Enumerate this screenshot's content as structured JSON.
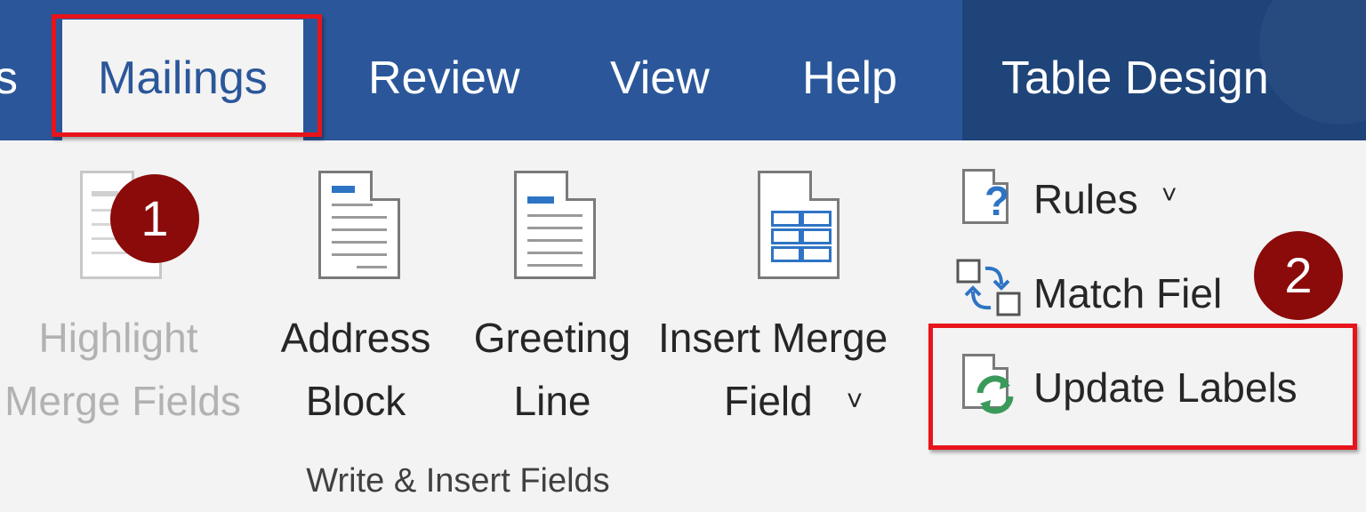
{
  "ribbon_tabs": {
    "partial_left": "s",
    "mailings": "Mailings",
    "review": "Review",
    "view": "View",
    "help": "Help",
    "table_design": "Table Design"
  },
  "buttons": {
    "highlight_line1": "Highlight",
    "highlight_line2": "Merge Fields",
    "address_line1": "Address",
    "address_line2": "Block",
    "greeting_line1": "Greeting",
    "greeting_line2": "Line",
    "insert_line1": "Insert Merge",
    "insert_line2": "Field",
    "rules": "Rules",
    "match_fields": "Match Fiel",
    "update_labels": "Update Labels",
    "dropdown_glyph": "˅"
  },
  "group_label": "Write & Insert Fields",
  "callouts": {
    "step1": "1",
    "step2": "2"
  },
  "colors": {
    "tab_bar": "#2b579a",
    "contextual_tab": "#1f4479",
    "highlight_box": "#e8141b",
    "callout": "#8b0a0a"
  }
}
